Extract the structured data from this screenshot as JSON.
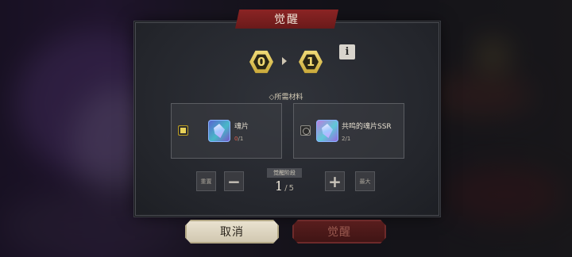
{
  "dialog": {
    "title": "觉醒",
    "level_from": "0",
    "level_to": "1",
    "info_label": "i",
    "materials_heading": "◇所需材料",
    "materials": [
      {
        "name": "魂片",
        "have": "0",
        "need": "/1",
        "selected": true
      },
      {
        "name": "共鸣的魂片SSR",
        "have": "2",
        "need": "/1",
        "selected": false
      }
    ],
    "stepper": {
      "reset_label": "重置",
      "minus_label": "−",
      "stage_label": "觉醒阶段",
      "current": "1",
      "separator": "/",
      "max": "5",
      "plus_label": "+",
      "max_label": "最大"
    },
    "cancel_label": "取消",
    "awaken_label": "觉醒"
  },
  "colors": {
    "banner": "#8b2424",
    "hex_gold": "#e0c45a",
    "count_insufficient": "#e0614f",
    "cancel_bg": "#e3dcc8",
    "awaken_bg": "#4d1a1a"
  }
}
